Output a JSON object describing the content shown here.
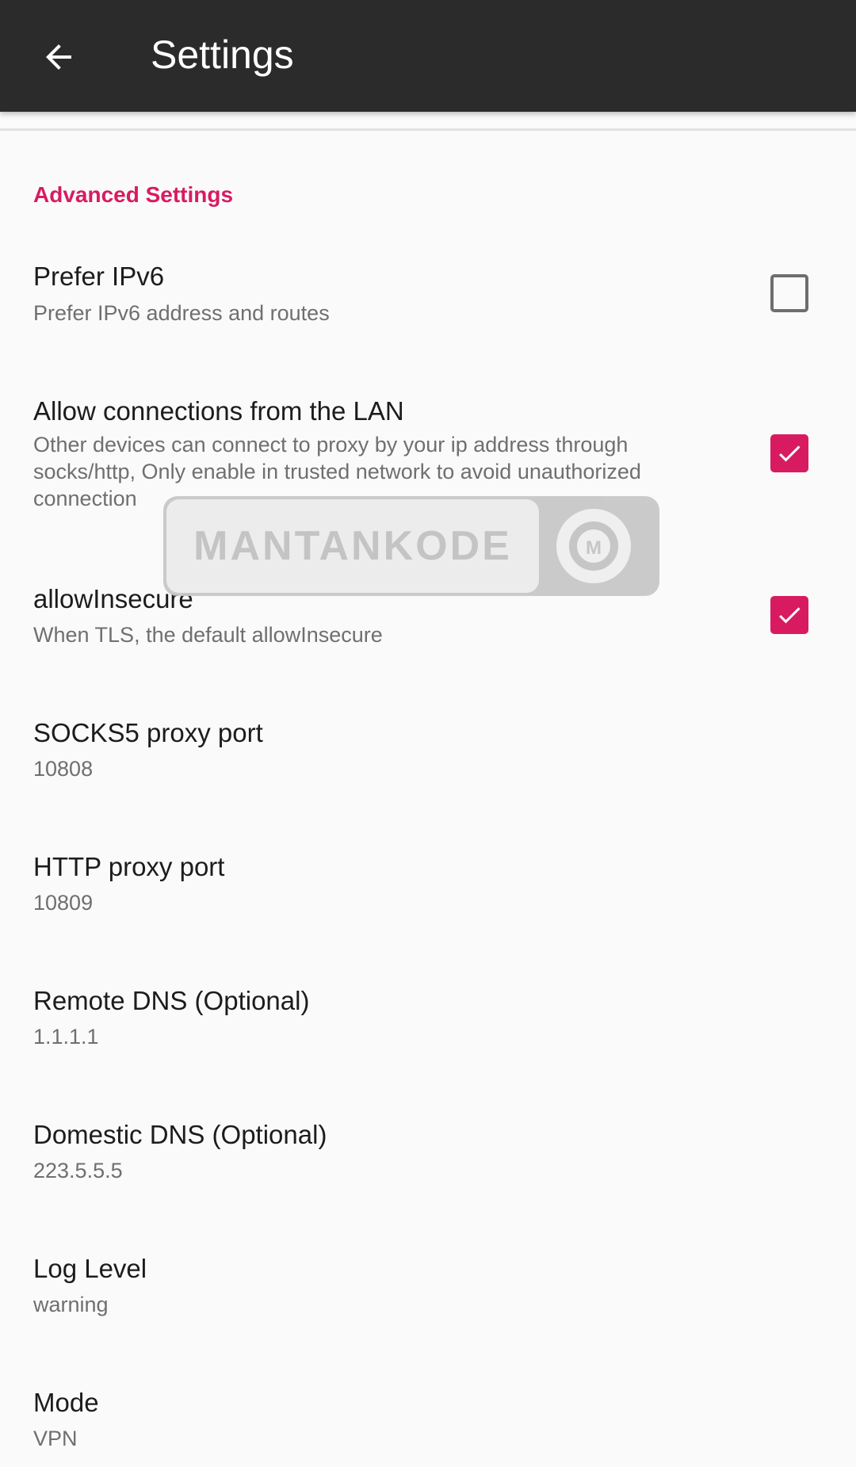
{
  "app_bar": {
    "title": "Settings",
    "back_icon": "arrow-back-icon",
    "background": "#2b2b2b"
  },
  "section": {
    "label": "Advanced Settings",
    "accent_color": "#d81b60"
  },
  "preferences": [
    {
      "title": "Prefer IPv6",
      "summary": "Prefer IPv6 address and routes",
      "checked": false
    },
    {
      "title": "Allow connections from the LAN",
      "summary": "Other devices can connect to proxy by your ip address through socks/http, Only enable in trusted network to avoid unauthorized connection",
      "checked": true
    },
    {
      "title": "allowInsecure",
      "summary": "When TLS, the default allowInsecure",
      "checked": true
    },
    {
      "title": "SOCKS5 proxy port",
      "summary": "10808"
    },
    {
      "title": "HTTP proxy port",
      "summary": "10809"
    },
    {
      "title": "Remote DNS (Optional)",
      "summary": "1.1.1.1"
    },
    {
      "title": "Domestic DNS (Optional)",
      "summary": "223.5.5.5"
    },
    {
      "title": "Log Level",
      "summary": "warning"
    },
    {
      "title": "Mode",
      "summary": "VPN"
    }
  ],
  "watermark": {
    "text": "MANTANKODE",
    "logo_letter": "M"
  },
  "colors": {
    "checkbox_checked": "#d81b60",
    "checkbox_unchecked_border": "#6e6e6e"
  }
}
